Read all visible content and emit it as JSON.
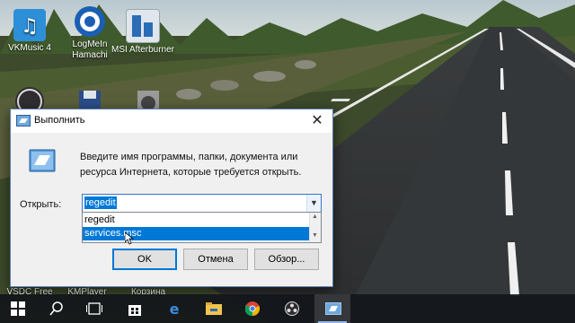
{
  "desktop": {
    "icons": [
      {
        "label": "VKMusic 4"
      },
      {
        "label": "LogMeIn Hamachi"
      },
      {
        "label": "MSI Afterburner"
      },
      {
        "label": "VSDC Free"
      },
      {
        "label": "KMPlayer"
      },
      {
        "label": "Корзина"
      }
    ]
  },
  "dialog": {
    "title": "Выполнить",
    "close_glyph": "✕",
    "description": "Введите имя программы, папки, документа или ресурса Интернета, которые требуется открыть.",
    "open_label": "Открыть:",
    "input_value": "regedit",
    "dropdown_items": [
      "regedit",
      "services.msc"
    ],
    "selected_item": "services.msc",
    "buttons": {
      "ok": "OK",
      "cancel": "Отмена",
      "browse": "Обзор..."
    }
  },
  "taskbar": {
    "items": [
      "windows-start-icon",
      "search-icon",
      "task-view-icon",
      "store-icon",
      "edge-icon",
      "file-explorer-icon",
      "chrome-icon",
      "obs-icon",
      "run-icon"
    ]
  },
  "colors": {
    "accent": "#0078d7",
    "taskbar": "#12161a"
  }
}
